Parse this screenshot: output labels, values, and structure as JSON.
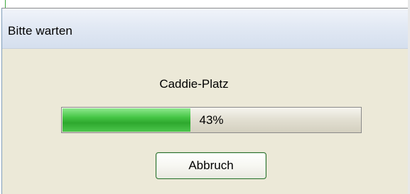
{
  "dialog": {
    "title": "Bitte warten",
    "status_text": "Caddie-Platz",
    "progress": {
      "value_percent": 43,
      "label": "43%",
      "fill_color": "#3cbc3c"
    },
    "cancel_label": "Abbruch"
  }
}
